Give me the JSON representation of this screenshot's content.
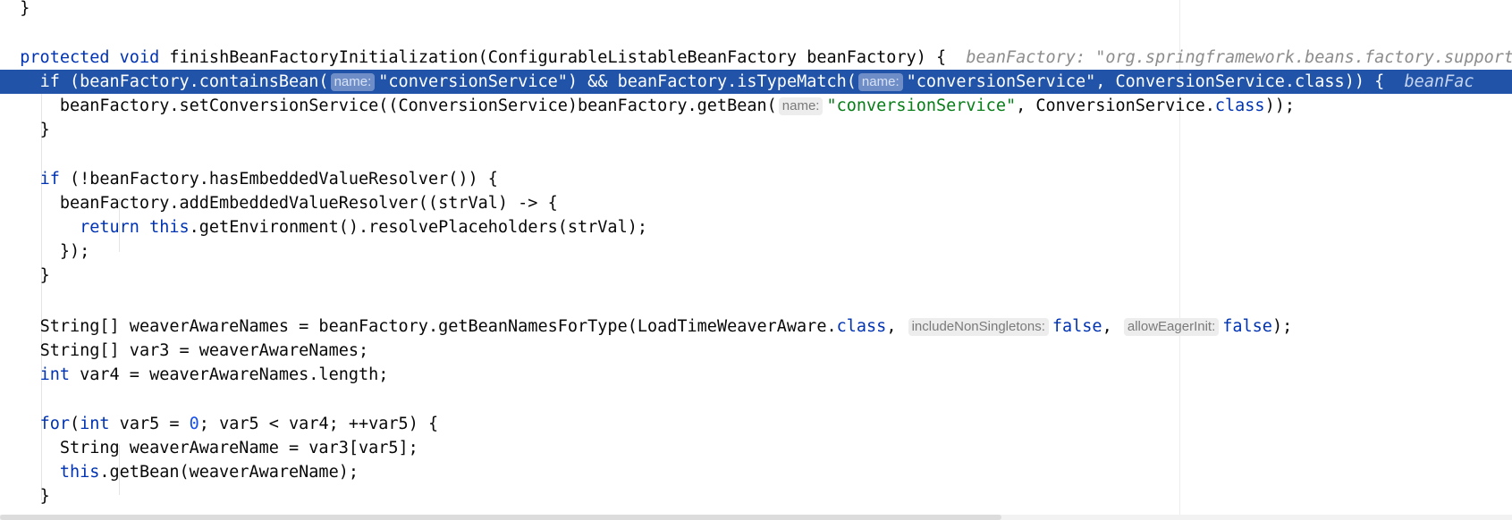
{
  "editor": {
    "line1": {
      "brace": "}"
    },
    "line2": {
      "kw_protected": "protected",
      "kw_void": "void",
      "signature": "finishBeanFactoryInitialization(ConfigurableListableBeanFactory beanFactory) {",
      "inlay": "beanFactory: \"org.springframework.beans.factory.support"
    },
    "line3": {
      "kw_if": "if",
      "part1": " (beanFactory.containsBean(",
      "hint1": "name:",
      "str1": "\"conversionService\"",
      "part2": ") && beanFactory.isTypeMatch(",
      "hint2": "name:",
      "str2": "\"conversionService\"",
      "part3": ", ConversionService.class)) {",
      "inlay": "beanFac"
    },
    "line4": {
      "part1": "beanFactory.setConversionService((ConversionService)beanFactory.getBean(",
      "hint": "name:",
      "str": "\"conversionService\"",
      "part2": ", ConversionService.",
      "kw_class": "class",
      "part3": "));"
    },
    "line5": {
      "brace": "}"
    },
    "line6": {
      "kw_if": "if",
      "rest": " (!beanFactory.hasEmbeddedValueResolver()) {"
    },
    "line7": {
      "text": "beanFactory.addEmbeddedValueResolver((strVal) -> {"
    },
    "line8": {
      "kw_return": "return",
      "kw_this": "this",
      "rest": ".getEnvironment().resolvePlaceholders(strVal);"
    },
    "line9": {
      "text": "});"
    },
    "line10": {
      "brace": "}"
    },
    "line11": {
      "part1": "String[] weaverAwareNames = beanFactory.getBeanNamesForType(LoadTimeWeaverAware.",
      "kw_class": "class",
      "comma1": ", ",
      "hint1": "includeNonSingletons:",
      "kw_false1": "false",
      "comma2": ", ",
      "hint2": "allowEagerInit:",
      "kw_false2": "false",
      "end": ");"
    },
    "line12": {
      "text": "String[] var3 = weaverAwareNames;"
    },
    "line13": {
      "kw_int": "int",
      "rest": " var4 = weaverAwareNames.length;"
    },
    "line14": {
      "kw_for": "for",
      "part1": "(",
      "kw_int": "int",
      "part2": " var5 = ",
      "num": "0",
      "part3": "; var5 < var4; ++var5) {"
    },
    "line15": {
      "text": "String weaverAwareName = var3[var5];"
    },
    "line16": {
      "kw_this": "this",
      "rest": ".getBean(weaverAwareName);"
    },
    "line17": {
      "brace": "}"
    }
  }
}
